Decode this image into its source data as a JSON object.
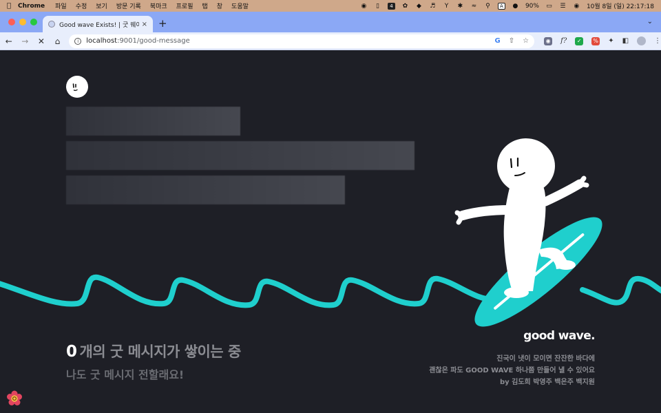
{
  "menubar": {
    "app_name": "Chrome",
    "items": [
      "파일",
      "수정",
      "보기",
      "방문 기록",
      "북마크",
      "프로필",
      "탭",
      "창",
      "도움말"
    ],
    "battery": "90%",
    "clock": "10월 8일 (일)  22:17:18",
    "status_badge": "4",
    "input_source": "A"
  },
  "browser": {
    "tab_title": "Good wave Exists! | 굿 웨이브",
    "url_host": "localhost",
    "url_path": ":9001/good-message",
    "colors": {
      "tabstrip": "#8ba8f5",
      "toolbar": "#e8eefc"
    }
  },
  "page": {
    "count": "0",
    "count_suffix": "개의 굿 메시지가 쌓이는 중",
    "cta": "나도 굿 메시지 전할래요!",
    "brand": "good wave.",
    "tagline_1": "진국이 냇이 모이면 잔잔한 바다에",
    "tagline_2": "괜찮은 파도 GOOD WAVE 하나쯤 만들어 낼 수 있어요",
    "credits": "by 김도희 박영주 백은주 백지원",
    "colors": {
      "background": "#1e1f26",
      "wave": "#1fcfcd",
      "surfboard": "#1fcfcd",
      "character": "#ffffff"
    }
  }
}
